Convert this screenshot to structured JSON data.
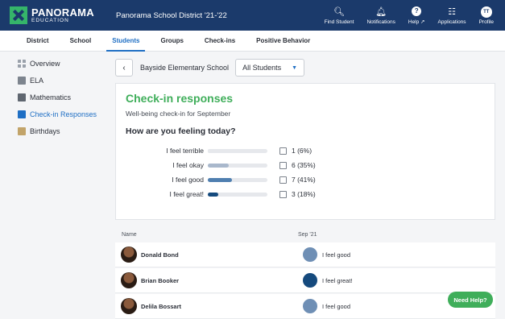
{
  "brand": {
    "name": "PANORAMA",
    "sub": "EDUCATION"
  },
  "header": {
    "district": "Panorama School District '21-'22",
    "actions": [
      {
        "label": "Find Student",
        "icon": "search-icon"
      },
      {
        "label": "Notifications",
        "icon": "bell-icon"
      },
      {
        "label": "Help ↗",
        "icon": "help-icon"
      },
      {
        "label": "Applications",
        "icon": "grid-icon"
      },
      {
        "label": "Profile",
        "icon": "profile-icon",
        "initials": "TT"
      }
    ]
  },
  "nav": {
    "tabs": [
      "District",
      "School",
      "Students",
      "Groups",
      "Check-ins",
      "Positive Behavior"
    ],
    "active": "Students"
  },
  "sidebar": {
    "items": [
      {
        "label": "Overview",
        "icon": "grid-icon"
      },
      {
        "label": "ELA",
        "icon": "book-icon"
      },
      {
        "label": "Mathematics",
        "icon": "calculator-icon"
      },
      {
        "label": "Check-in Responses",
        "icon": "checkin-icon",
        "active": true
      },
      {
        "label": "Birthdays",
        "icon": "cake-icon"
      }
    ]
  },
  "filters": {
    "back": "‹",
    "school": "Bayside Elementary School",
    "group_select": "All Students"
  },
  "card": {
    "title": "Check-in responses",
    "subtitle": "Well-being check-in for September",
    "question": "How are you feeling today?",
    "responses": [
      {
        "label": "I feel terrible",
        "count": "1 (6%)",
        "pct": 0.06,
        "color": "#e6e8ec"
      },
      {
        "label": "I feel okay",
        "count": "6 (35%)",
        "pct": 0.35,
        "color": "#a9b8cc"
      },
      {
        "label": "I feel good",
        "count": "7 (41%)",
        "pct": 0.41,
        "color": "#4f7fb0"
      },
      {
        "label": "I feel great!",
        "count": "3 (18%)",
        "pct": 0.18,
        "color": "#154a7d"
      }
    ]
  },
  "table": {
    "col_name": "Name",
    "col_date": "Sep '21",
    "rows": [
      {
        "name": "Donald Bond",
        "response": "I feel good",
        "color": "#6f8fb5"
      },
      {
        "name": "Brian Booker",
        "response": "I feel great!",
        "color": "#154a7d"
      },
      {
        "name": "Delila Bossart",
        "response": "I feel good",
        "color": "#6f8fb5"
      }
    ]
  },
  "help_button": "Need Help?"
}
